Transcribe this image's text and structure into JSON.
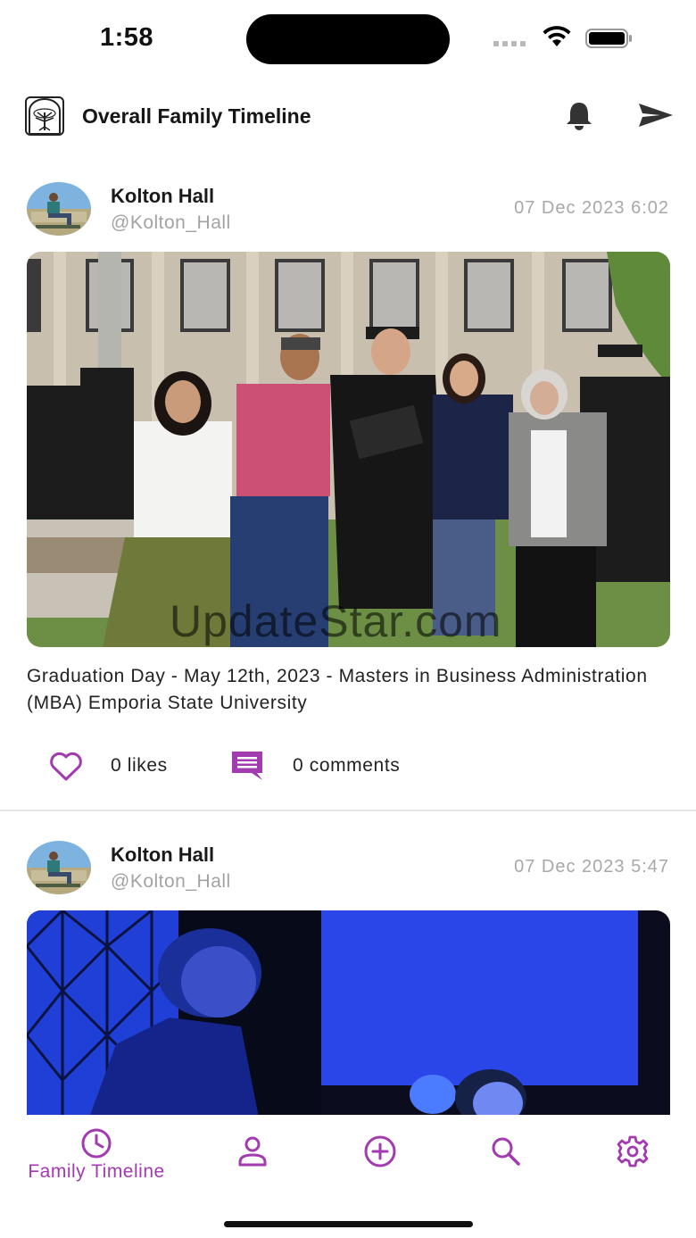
{
  "status_bar": {
    "time": "1:58"
  },
  "header": {
    "title": "Overall Family Timeline"
  },
  "posts": [
    {
      "author": "Kolton Hall",
      "handle": "@Kolton_Hall",
      "date": "07 Dec 2023 6:02",
      "caption": "Graduation Day - May 12th, 2023 - Masters in Business Administration (MBA) Emporia State University",
      "likes": "0 likes",
      "comments": "0 comments",
      "watermark": "UpdateStar.com"
    },
    {
      "author": "Kolton Hall",
      "handle": "@Kolton_Hall",
      "date": "07 Dec 2023 5:47"
    }
  ],
  "bottom_nav": {
    "items": [
      {
        "icon": "clock-icon",
        "label": "Family Timeline",
        "active": true
      },
      {
        "icon": "person-icon",
        "label": ""
      },
      {
        "icon": "add-circle-icon",
        "label": ""
      },
      {
        "icon": "search-icon",
        "label": ""
      },
      {
        "icon": "gear-icon",
        "label": ""
      }
    ]
  },
  "colors": {
    "accent": "#a23ab0",
    "icon_dark": "#333333"
  }
}
